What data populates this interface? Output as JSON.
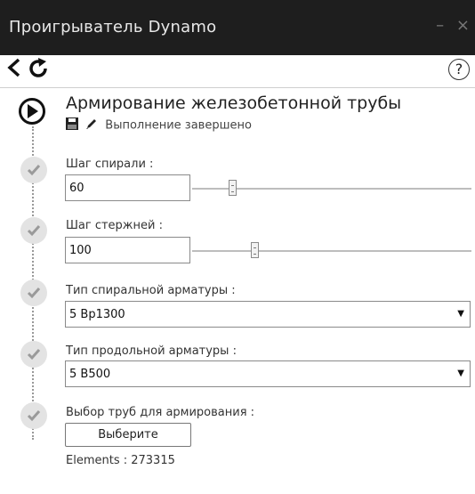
{
  "window": {
    "title": "Проигрыватель Dynamo",
    "minimize_label": "–",
    "close_label": "×"
  },
  "toolbar": {
    "back_icon": "back-arrow-icon",
    "refresh_icon": "refresh-icon",
    "help_label": "?"
  },
  "graph": {
    "title": "Армирование железобетонной трубы",
    "status": "Выполнение завершено"
  },
  "inputs": [
    {
      "label": "Шаг спирали :",
      "value": "60",
      "slider_fraction": 0.13
    },
    {
      "label": "Шаг стержней :",
      "value": "100",
      "slider_fraction": 0.21
    },
    {
      "label": "Тип спиральной арматуры :",
      "value": "5 Вр1300"
    },
    {
      "label": "Тип продольной арматуры :",
      "value": "5 В500"
    },
    {
      "label": "Выбор труб для армирования :",
      "button_label": "Выберите",
      "elements_text": "Elements : 273315"
    }
  ],
  "colors": {
    "titlebar_bg": "#1e1e1e",
    "check_bg": "#e3e3e3"
  }
}
